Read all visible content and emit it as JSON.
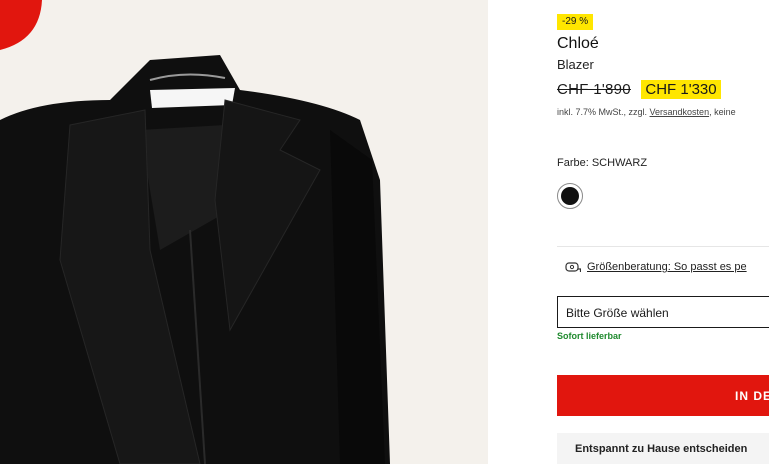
{
  "product": {
    "discount_badge": "-29 %",
    "brand": "Chloé",
    "type": "Blazer",
    "old_price": "CHF 1'890",
    "new_price": "CHF 1'330",
    "tax_note_prefix": "inkl. 7.7% MwSt., zzgl. ",
    "shipping_link": "Versandkosten",
    "tax_note_suffix": ", keine"
  },
  "color": {
    "label": "Farbe: SCHWARZ",
    "swatch_color": "#111111"
  },
  "size": {
    "advice_link": "Größenberatung: So passt es pe",
    "select_placeholder": "Bitte Größe wählen",
    "availability": "Sofort lieferbar"
  },
  "actions": {
    "cart_label": "IN DE",
    "home_info": "Entspannt zu Hause entscheiden"
  },
  "colors": {
    "badge_yellow": "#ffe600",
    "cart_red": "#e1160e",
    "availability_green": "#1f8a2e",
    "image_background": "#f4f1ec"
  }
}
